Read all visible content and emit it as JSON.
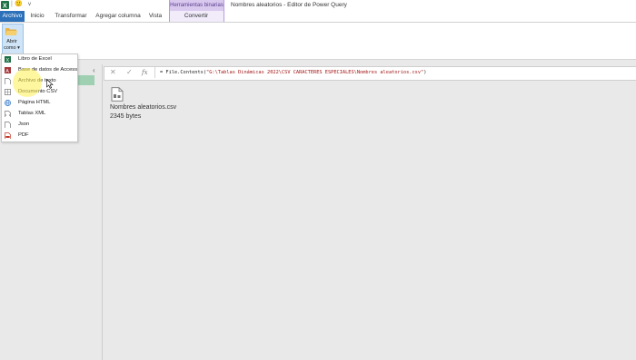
{
  "quick_access": {
    "dropdown_glyph": "v",
    "smiley": "🙂"
  },
  "window": {
    "title": "Nombres aleatorios - Editor de Power Query"
  },
  "ribbon": {
    "contextual_group_label": "Herramientas binarias",
    "tabs": [
      {
        "label": "Archivo"
      },
      {
        "label": "Inicio"
      },
      {
        "label": "Transformar"
      },
      {
        "label": "Agregar columna"
      },
      {
        "label": "Vista"
      },
      {
        "label": "Convertir"
      }
    ],
    "open_as_label_1": "Abrir",
    "open_as_label_2": "como ▾"
  },
  "open_as_menu": {
    "items": [
      {
        "label": "Libro de Excel",
        "icon": "excel-icon"
      },
      {
        "label": "Base de datos de Access",
        "icon": "access-icon"
      },
      {
        "label": "Archivo de texto",
        "icon": "text-file-icon"
      },
      {
        "label": "Documento CSV",
        "icon": "csv-icon"
      },
      {
        "label": "Página HTML",
        "icon": "globe-icon"
      },
      {
        "label": "Tablas XML",
        "icon": "xml-icon"
      },
      {
        "label": "Json",
        "icon": "json-icon"
      },
      {
        "label": "PDF",
        "icon": "pdf-icon"
      }
    ]
  },
  "formula_bar": {
    "cancel_glyph": "✕",
    "commit_glyph": "✓",
    "fx_glyph": "fx",
    "formula_prefix": "= File.Contents(",
    "formula_string": "\"G:\\Tablas Dinámicas 2022\\CSV CARACTERES ESPECIALES\\Nombres aleatorios.csv\"",
    "formula_suffix": ")"
  },
  "content": {
    "file_name": "Nombres aleatorios.csv",
    "file_size": "2345 bytes"
  },
  "colors": {
    "archivo_tab": "#2b70b8",
    "contextual_tab": "#d9c9ef",
    "selected_query": "#9fd0b2",
    "highlight": "#fff050"
  }
}
